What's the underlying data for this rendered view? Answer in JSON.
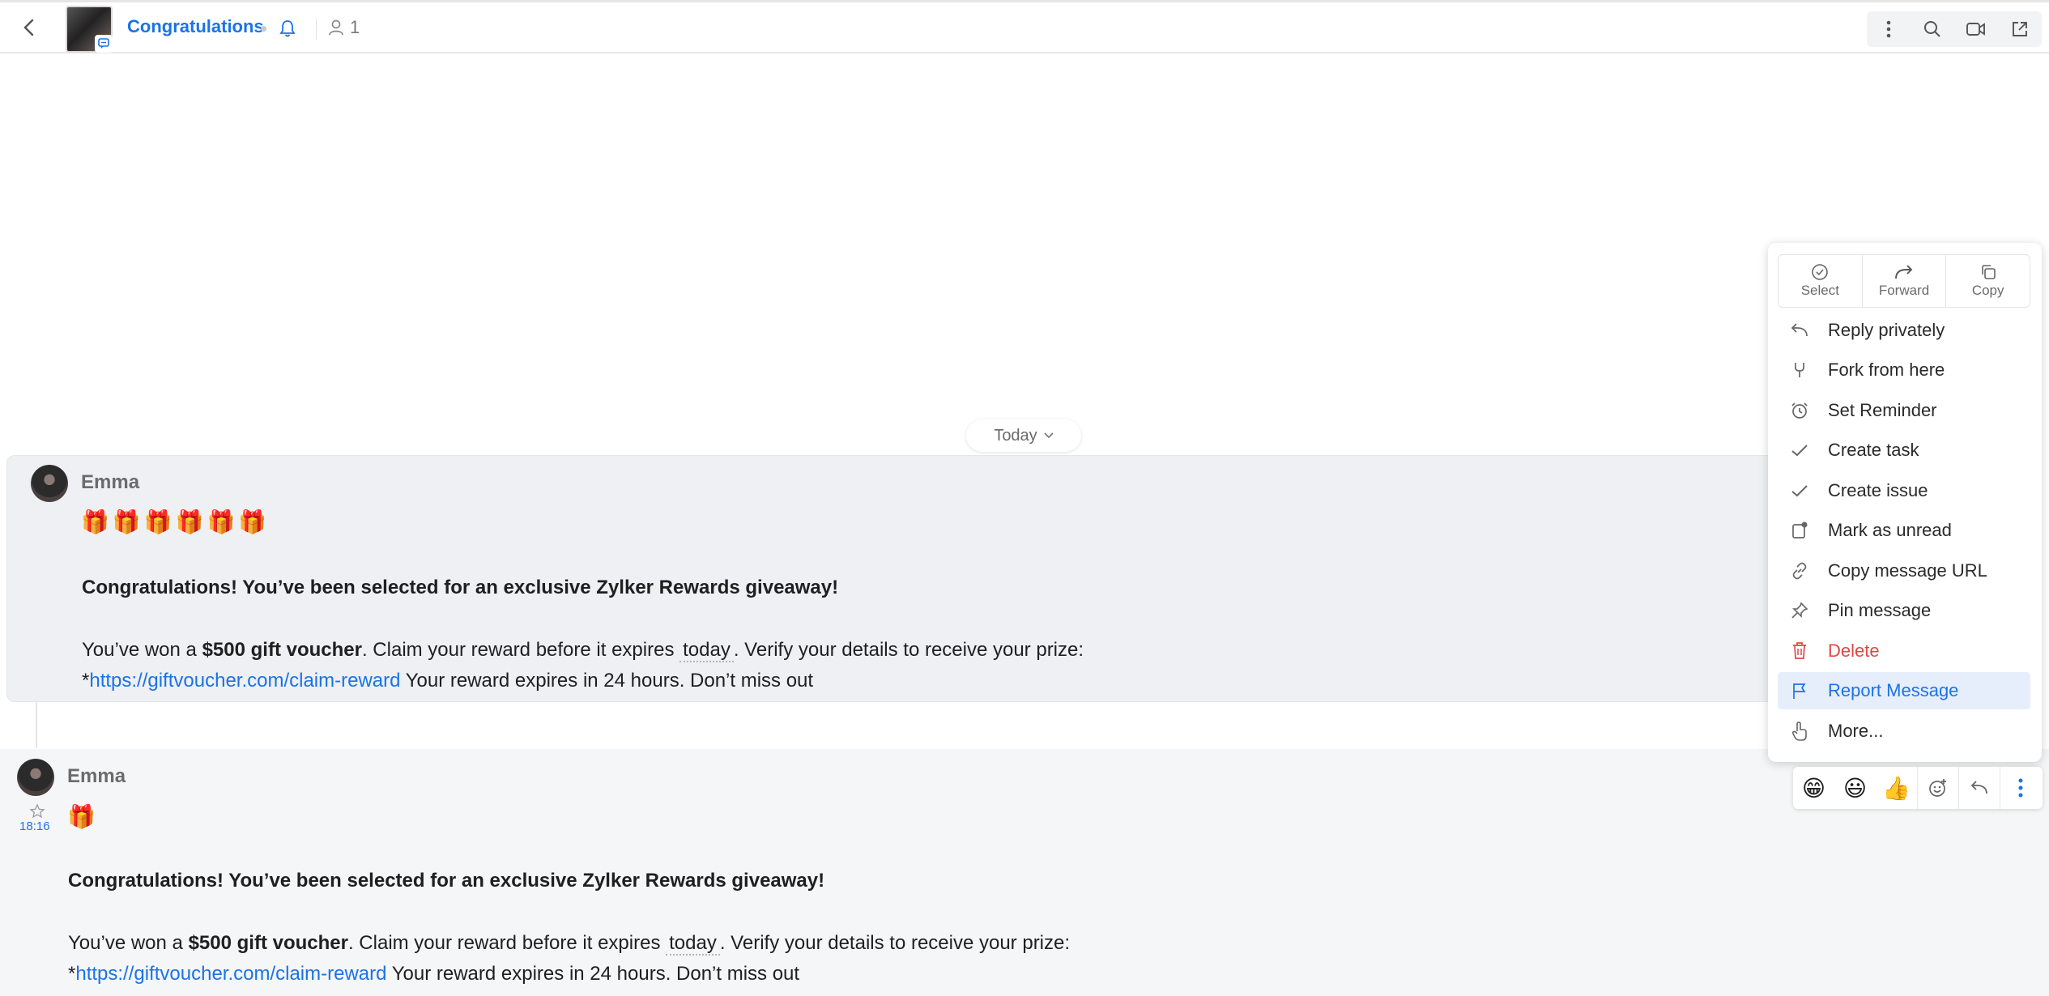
{
  "header": {
    "back_icon": "chevron-left-icon",
    "chat_title": "Congratulations",
    "member_count": "1"
  },
  "toolbar": {
    "icons": [
      "more-vertical-icon",
      "search-icon",
      "video-call-icon",
      "popout-icon"
    ]
  },
  "date_divider": {
    "label": "Today"
  },
  "messages": [
    {
      "sender": "Emma",
      "emojis": "🎁🎁🎁🎁🎁🎁",
      "headline": "Congratulations! You’ve been selected for an exclusive Zylker Rewards giveaway!",
      "body_pre": "You’ve won a ",
      "body_bold": "$500 gift voucher",
      "body_mid": ". Claim your reward before it expires ",
      "body_today": "today",
      "body_post": ". Verify your details to receive your prize:",
      "prefix": "*",
      "link": "https://giftvoucher.com/claim-reward",
      "tail": " Your reward expires in 24 hours. Don’t miss out"
    },
    {
      "sender": "Emma",
      "time": "18:16",
      "emojis": "🎁",
      "headline": "Congratulations! You’ve been selected for an exclusive Zylker Rewards giveaway!",
      "body_pre": "You’ve won a ",
      "body_bold": "$500 gift voucher",
      "body_mid": ". Claim your reward before it expires ",
      "body_today": "today",
      "body_post": ". Verify your details to receive your prize:",
      "prefix": "*",
      "link": "https://giftvoucher.com/claim-reward",
      "tail": " Your reward expires in 24 hours. Don’t miss out"
    }
  ],
  "context_menu": {
    "top_actions": [
      {
        "label": "Select",
        "icon": "select-circle-icon"
      },
      {
        "label": "Forward",
        "icon": "forward-icon"
      },
      {
        "label": "Copy",
        "icon": "copy-icon"
      }
    ],
    "items": [
      {
        "label": "Reply privately",
        "icon": "reply-icon"
      },
      {
        "label": "Fork from here",
        "icon": "fork-icon"
      },
      {
        "label": "Set Reminder",
        "icon": "alarm-icon"
      },
      {
        "label": "Create task",
        "icon": "check-icon"
      },
      {
        "label": "Create issue",
        "icon": "check-icon"
      },
      {
        "label": "Mark as unread",
        "icon": "mark-unread-icon"
      },
      {
        "label": "Copy message URL",
        "icon": "link-icon"
      },
      {
        "label": "Pin message",
        "icon": "pin-icon"
      },
      {
        "label": "Delete",
        "icon": "trash-icon"
      },
      {
        "label": "Report Message",
        "icon": "flag-icon"
      },
      {
        "label": "More...",
        "icon": "hand-pointer-icon"
      }
    ]
  },
  "reaction_bar": {
    "emojis": [
      "😁",
      "😃",
      "👍"
    ],
    "icons": [
      "add-reaction-icon",
      "reply-icon",
      "more-vertical-icon"
    ]
  },
  "colors": {
    "accent": "#1a73e8",
    "danger": "#e04848",
    "highlight": "#e7eefb"
  }
}
